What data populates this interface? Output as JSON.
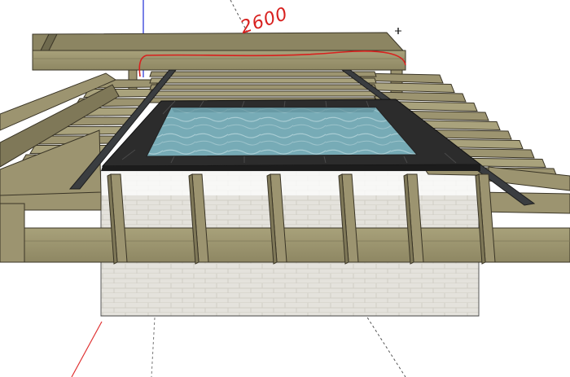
{
  "viewport": {
    "background": "#ffffff",
    "annotation_text": "2600",
    "annotation_color": "#d8201e"
  },
  "materials": {
    "wood": "#9c9470",
    "wood_light": "#a9a27c",
    "wood_dark": "#7f7858",
    "wood_edge": "#3a3526",
    "brick": "#e4e2dc",
    "brick_line": "#cfccc4",
    "water": "#74a9b4",
    "water_light": "#a9cdd4",
    "coping": "#2c2c2c",
    "steel": "#3a3d40"
  },
  "axes": {
    "blue": "#1f2bd6",
    "red": "#e03232",
    "green": "#22b04a"
  }
}
